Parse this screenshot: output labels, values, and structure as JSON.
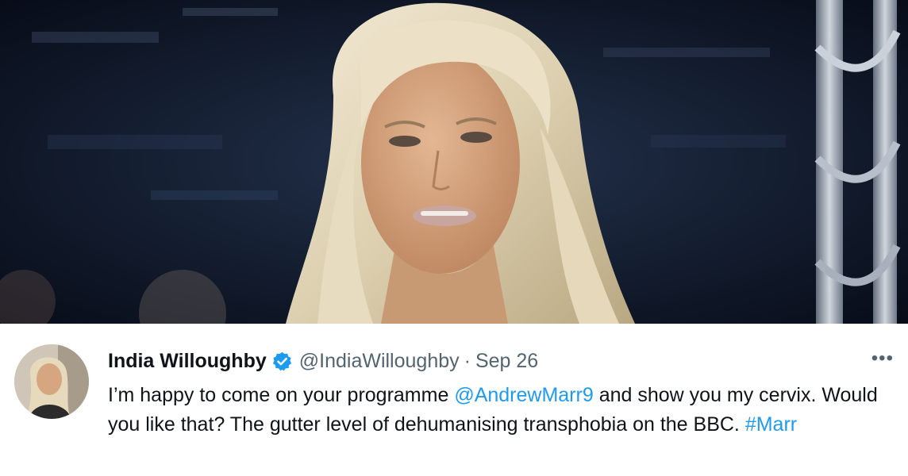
{
  "tweet": {
    "author_name": "India Willoughby",
    "handle": "@IndiaWilloughby",
    "separator": "·",
    "date": "Sep 26",
    "verified": true,
    "more_icon": "more-horizontal-icon",
    "more_label": "•••",
    "text": {
      "part1": "I’m happy to come on your programme ",
      "mention": "@AndrewMarr9",
      "part2": " and show you my cervix. Would you like that? The gutter level of dehumanising transphobia on the BBC. ",
      "hashtag": "#Marr"
    }
  },
  "colors": {
    "text": "#0f1419",
    "secondary": "#536471",
    "link": "#1d9bf0",
    "verified_badge": "#1d9bf0"
  }
}
